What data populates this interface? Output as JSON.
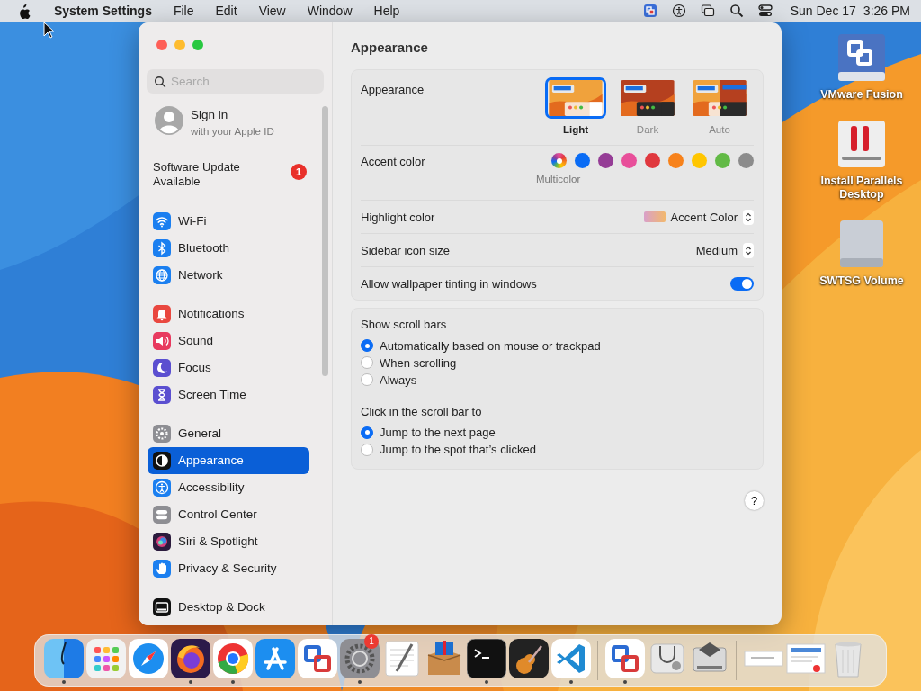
{
  "menu_bar": {
    "app": "System Settings",
    "menus": [
      "File",
      "Edit",
      "View",
      "Window",
      "Help"
    ],
    "date": "Sun Dec 17",
    "time": "3:26 PM"
  },
  "desktop_icons": [
    {
      "label": "VMware Fusion",
      "kind": "vmware"
    },
    {
      "label": "Install Parallels Desktop",
      "kind": "parallels"
    },
    {
      "label": "SWTSG Volume",
      "kind": "disk"
    }
  ],
  "window": {
    "search": {
      "placeholder": "Search"
    },
    "account": {
      "title": "Sign in",
      "subtitle": "with your Apple ID"
    },
    "update": {
      "label": "Software Update Available",
      "badge": "1"
    },
    "sidebar": [
      {
        "items": [
          {
            "label": "Wi-Fi",
            "kind": "wifi",
            "selected": false
          },
          {
            "label": "Bluetooth",
            "kind": "bluetooth",
            "selected": false
          },
          {
            "label": "Network",
            "kind": "network",
            "selected": false
          }
        ]
      },
      {
        "items": [
          {
            "label": "Notifications",
            "kind": "notifications",
            "selected": false
          },
          {
            "label": "Sound",
            "kind": "sound",
            "selected": false
          },
          {
            "label": "Focus",
            "kind": "focus",
            "selected": false
          },
          {
            "label": "Screen Time",
            "kind": "screentime",
            "selected": false
          }
        ]
      },
      {
        "items": [
          {
            "label": "General",
            "kind": "general",
            "selected": false
          },
          {
            "label": "Appearance",
            "kind": "appearance",
            "selected": true
          },
          {
            "label": "Accessibility",
            "kind": "accessibility",
            "selected": false
          },
          {
            "label": "Control Center",
            "kind": "controlcenter",
            "selected": false
          },
          {
            "label": "Siri & Spotlight",
            "kind": "siri",
            "selected": false
          },
          {
            "label": "Privacy & Security",
            "kind": "privacy",
            "selected": false
          }
        ]
      },
      {
        "items": [
          {
            "label": "Desktop & Dock",
            "kind": "desktop",
            "selected": false
          }
        ]
      }
    ],
    "title": "Appearance",
    "appearance": {
      "label": "Appearance",
      "options": [
        {
          "label": "Light",
          "kind": "light",
          "selected": true
        },
        {
          "label": "Dark",
          "kind": "dark",
          "selected": false
        },
        {
          "label": "Auto",
          "kind": "auto",
          "selected": false
        }
      ]
    },
    "accent": {
      "label": "Accent color",
      "caption": "Multicolor",
      "colors": [
        {
          "kind": "multicolor",
          "selected": true
        },
        {
          "color": "#0a6cf5",
          "selected": false
        },
        {
          "color": "#953d96",
          "selected": false
        },
        {
          "color": "#e84f9a",
          "selected": false
        },
        {
          "color": "#e0383e",
          "selected": false
        },
        {
          "color": "#f7821b",
          "selected": false
        },
        {
          "color": "#ffc600",
          "selected": false
        },
        {
          "color": "#62ba46",
          "selected": false
        },
        {
          "color": "#8c8c8c",
          "selected": false
        }
      ]
    },
    "highlight": {
      "label": "Highlight color",
      "value": "Accent Color"
    },
    "icon_size": {
      "label": "Sidebar icon size",
      "value": "Medium"
    },
    "tinting": {
      "label": "Allow wallpaper tinting in windows",
      "on": true
    },
    "scroll_groups": [
      {
        "label": "Show scroll bars",
        "options": [
          {
            "label": "Automatically based on mouse or trackpad",
            "selected": true
          },
          {
            "label": "When scrolling",
            "selected": false
          },
          {
            "label": "Always",
            "selected": false
          }
        ]
      },
      {
        "label": "Click in the scroll bar to",
        "options": [
          {
            "label": "Jump to the next page",
            "selected": true
          },
          {
            "label": "Jump to the spot that’s clicked",
            "selected": false
          }
        ]
      }
    ],
    "help": "?"
  },
  "dock": [
    {
      "items": [
        {
          "kind": "finder",
          "running": true
        },
        {
          "kind": "launchpad",
          "running": false
        },
        {
          "kind": "safari",
          "running": false
        },
        {
          "kind": "firefox",
          "running": true
        },
        {
          "kind": "chrome",
          "running": true
        },
        {
          "kind": "appstore",
          "running": false
        },
        {
          "kind": "vmware",
          "running": false
        },
        {
          "kind": "settings",
          "running": true,
          "badge": "1"
        },
        {
          "kind": "textedit",
          "running": false
        },
        {
          "kind": "parallels",
          "running": false
        },
        {
          "kind": "terminal",
          "running": true
        },
        {
          "kind": "garageband",
          "running": false
        },
        {
          "kind": "vscode",
          "running": true
        }
      ]
    },
    {
      "items": [
        {
          "kind": "vmware",
          "running": true
        },
        {
          "kind": "diskutility",
          "running": false
        },
        {
          "kind": "bootcamp",
          "running": false
        }
      ]
    },
    {
      "items": [
        {
          "kind": "window",
          "running": false
        },
        {
          "kind": "window2",
          "running": false
        },
        {
          "kind": "trash",
          "running": false
        }
      ]
    }
  ]
}
